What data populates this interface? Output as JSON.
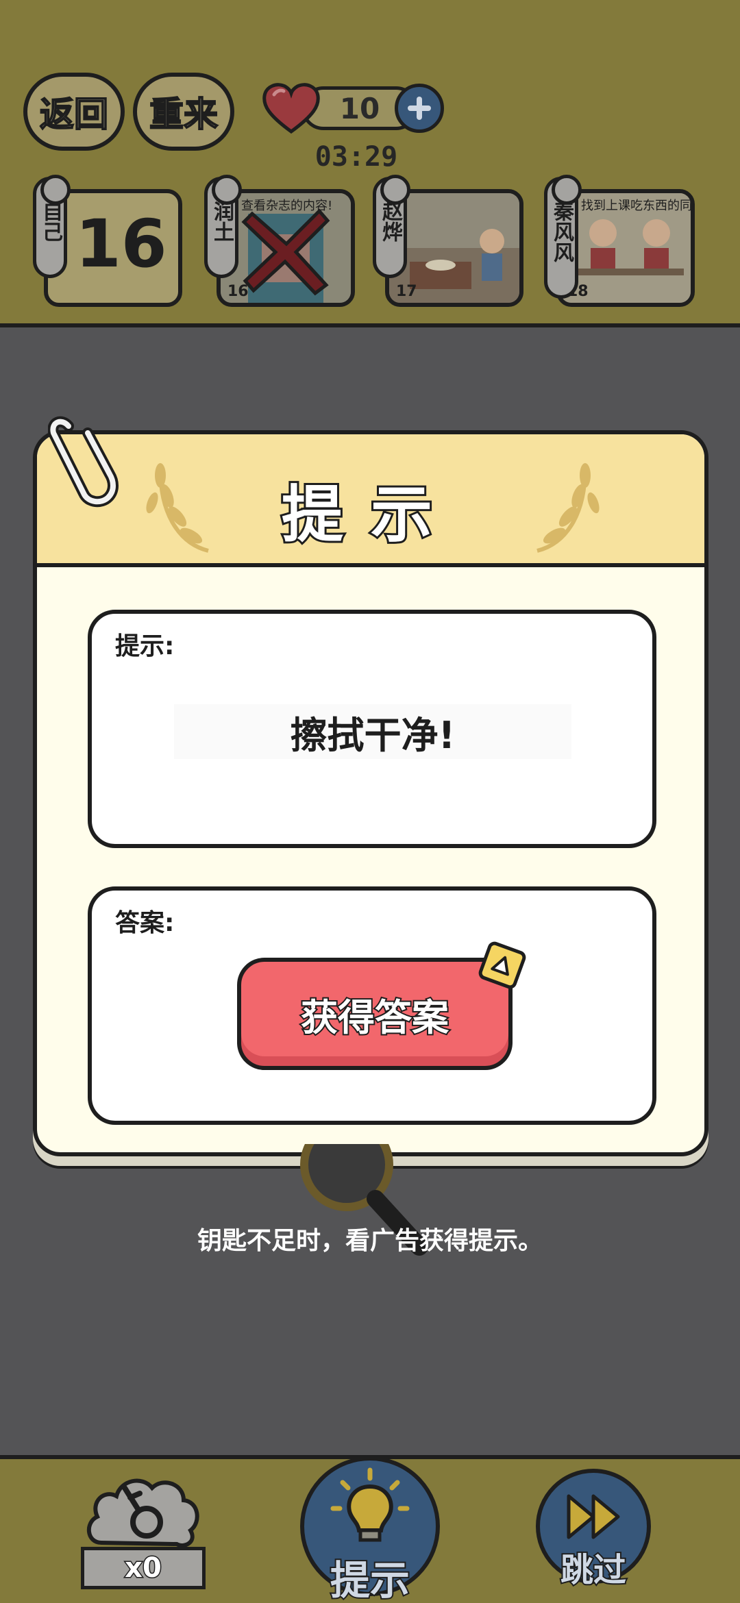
{
  "header": {
    "back_label": "返回",
    "restart_label": "重来",
    "lives": "10",
    "timer": "03:29"
  },
  "levels": [
    {
      "tag": "自己",
      "big_number": "16"
    },
    {
      "tag": "润土",
      "caption": "查看杂志的内容!",
      "number": "16",
      "status": "failed"
    },
    {
      "tag": "赵烨",
      "number": "17"
    },
    {
      "tag": "秦风风",
      "caption": "找到上课吃东西的同学!",
      "number": "18"
    }
  ],
  "modal": {
    "title": "提示",
    "hint_label": "提示:",
    "hint_text": "擦拭干净!",
    "answer_label": "答案:",
    "get_answer_label": "获得答案"
  },
  "tip": "钥匙不足时，看广告获得提示。",
  "footer": {
    "keys_count": "x0",
    "hint_label": "提示",
    "skip_label": "跳过"
  },
  "colors": {
    "header_bg": "#837a3b",
    "modal_head": "#f7e29e",
    "modal_body": "#fffdeb",
    "button_red": "#f2676c",
    "button_blue": "#37577a"
  }
}
